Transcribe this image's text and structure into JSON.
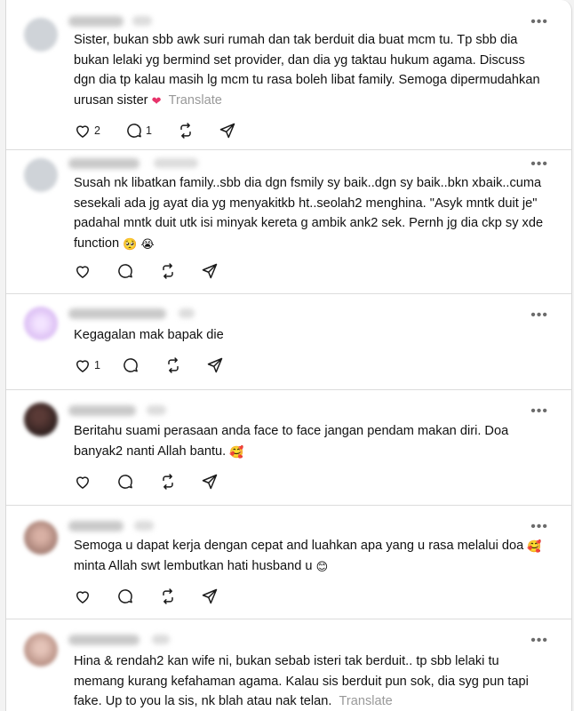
{
  "colors": {
    "text": "#101010",
    "muted": "#999999",
    "heart": "#e7336a",
    "icon": "#1a1a1a"
  },
  "posts": [
    {
      "more_label": "•••",
      "lines": [
        "Sister, bukan sbb awk suri rumah dan tak berduit dia buat mcm tu. Tp sbb dia",
        "bukan lelaki yg bermind set provider, dan dia yg taktau hukum agama. Discuss",
        "dgn dia tp kalau masih lg mcm tu rasa boleh libat family. Semoga dipermudahkan"
      ],
      "last_line": "urusan sister",
      "emoji": "heart-emoji",
      "translate": "Translate",
      "likes": "2",
      "replies": "1"
    },
    {
      "more_label": "•••",
      "lines": [
        "Susah nk libatkan family..sbb dia dgn fsmily sy baik..dgn sy baik..bkn xbaik..cuma",
        "sesekali ada jg ayat dia yg menyakitkb ht..seolah2 menghina. \"Asyk mntk duit je\"",
        "padahal mntk duit utk isi minyak kereta g ambik ank2 sek. Pernh jg dia ckp sy xde"
      ],
      "last_line": "function",
      "emoji": "crying-emojis"
    },
    {
      "more_label": "•••",
      "text": "Kegagalan mak bapak die",
      "likes": "1"
    },
    {
      "more_label": "•••",
      "line1": "Beritahu suami perasaan anda face to face jangan pendam makan diri. Doa",
      "line2": "banyak2 nanti Allah bantu.",
      "emoji": "hearts-face-emoji"
    },
    {
      "more_label": "•••",
      "line1": "Semoga u dapat kerja dengan cepat and luahkan apa yang u rasa melalui doa",
      "line2": "minta Allah swt lembutkan hati husband u",
      "emoji1": "hearts-face-emoji",
      "emoji2": "smiling-face-emoji"
    },
    {
      "more_label": "•••",
      "lines": [
        "Hina & rendah2 kan wife ni, bukan sebab isteri tak berduit.. tp sbb lelaki tu",
        "memang kurang kefahaman agama. Kalau sis berduit pun sok, dia syg pun tapi"
      ],
      "last_line": "fake. Up to you la sis, nk blah atau nak telan.",
      "translate": "Translate"
    }
  ]
}
